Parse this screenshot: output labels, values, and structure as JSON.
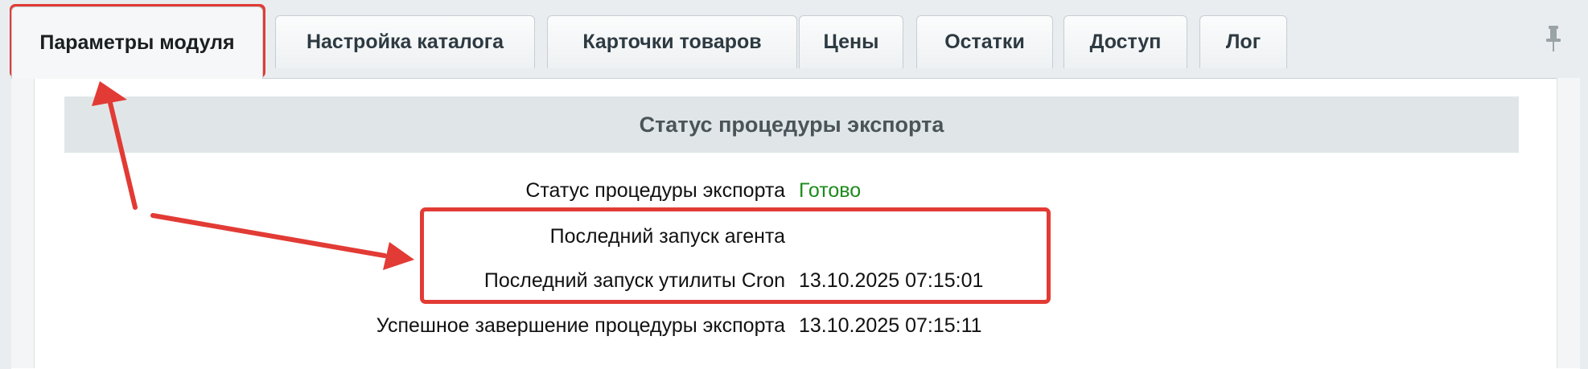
{
  "tabs": [
    {
      "label": "Параметры модуля",
      "active": true
    },
    {
      "label": "Настройка каталога",
      "active": false
    },
    {
      "label": "Карточки товаров",
      "active": false
    },
    {
      "label": "Цены",
      "active": false
    },
    {
      "label": "Остатки",
      "active": false
    },
    {
      "label": "Доступ",
      "active": false
    },
    {
      "label": "Лог",
      "active": false
    }
  ],
  "pin_icon": "pushpin-icon",
  "section": {
    "title": "Статус процедуры экспорта"
  },
  "rows": [
    {
      "label": "Статус процедуры экспорта",
      "value": "Готово"
    },
    {
      "label": "Последний запуск агента",
      "value": ""
    },
    {
      "label": "Последний запуск утилиты Cron",
      "value": "13.10.2025 07:15:01"
    },
    {
      "label": "Успешное завершение процедуры экспорта",
      "value": "13.10.2025 07:15:11"
    }
  ],
  "colors": {
    "annotation": "#e23b35",
    "status_ok": "#1d8a1d",
    "header_bg": "#e0e6e8"
  }
}
